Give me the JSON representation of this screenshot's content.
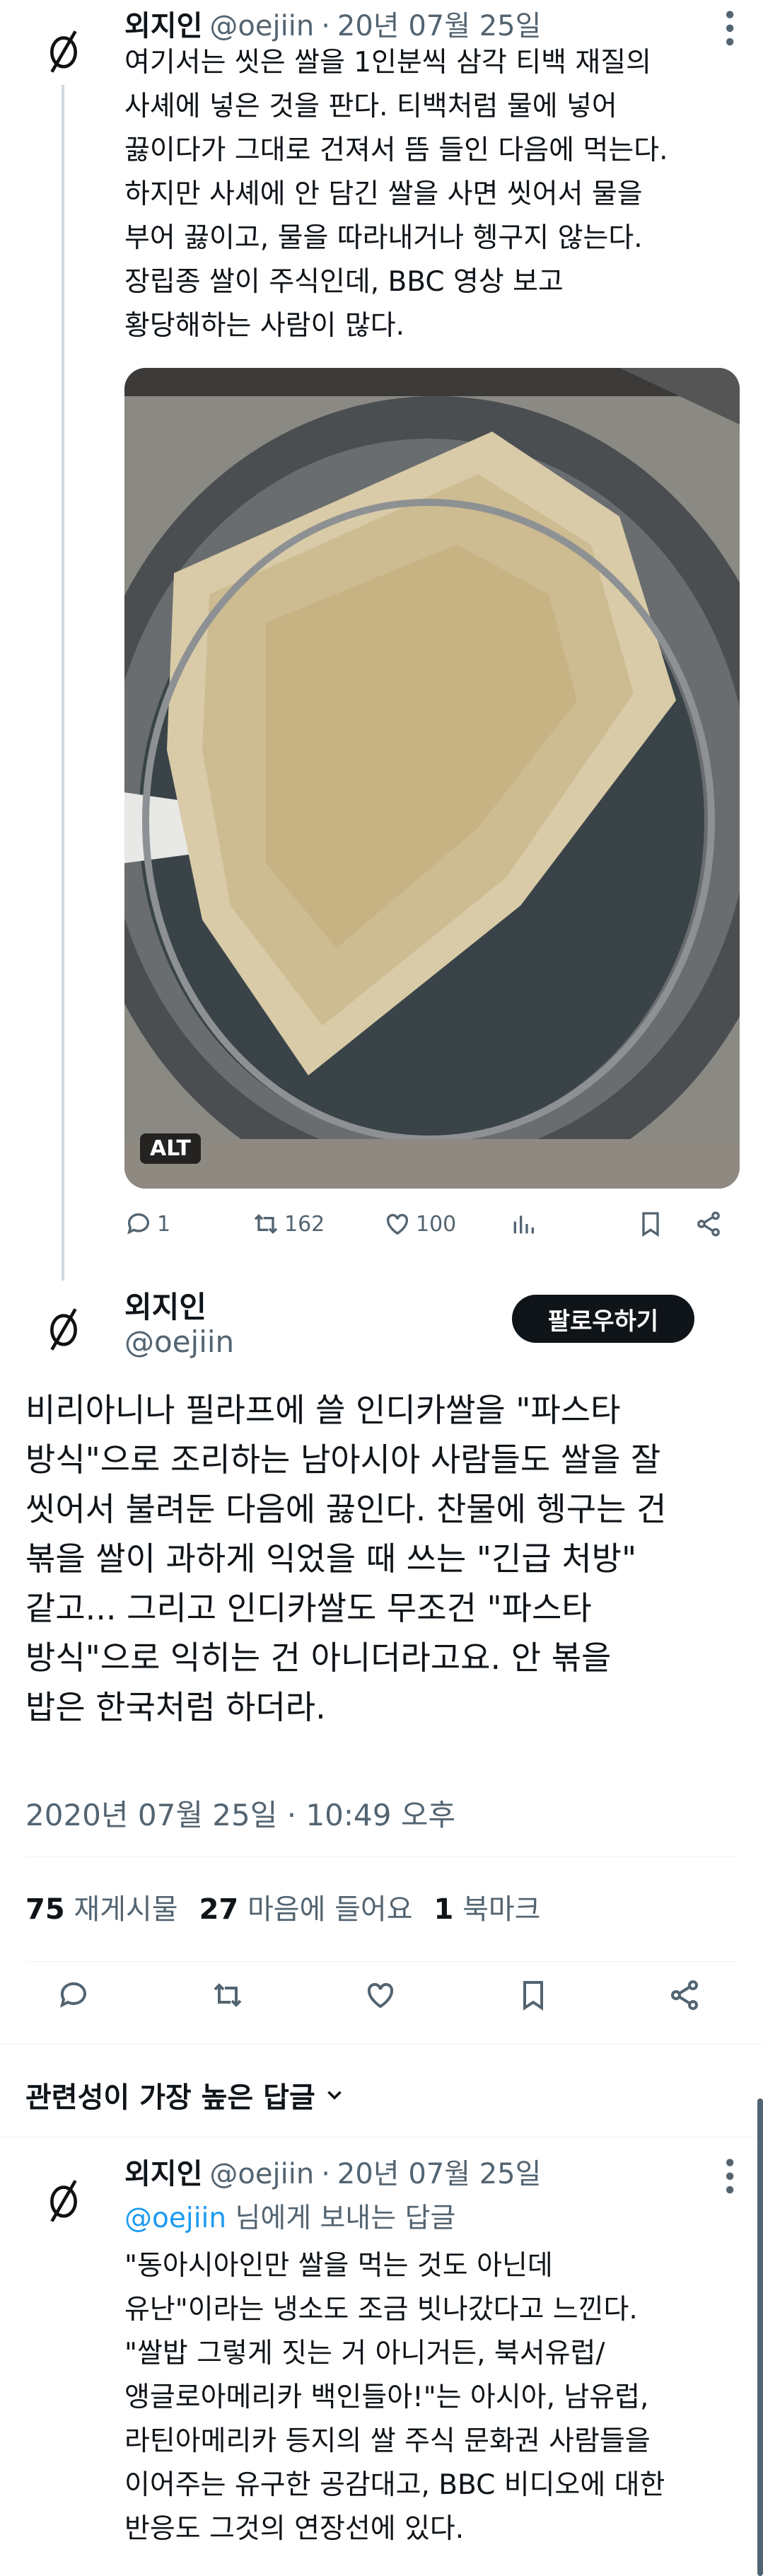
{
  "tweet1": {
    "name": "외지인",
    "handle": "@oejiin",
    "date": "20년 07월 25일",
    "text": "여기서는 씻은 쌀을 1인분씩 삼각 티백 재질의\n사셰에 넣은 것을 판다. 티백처럼 물에 넣어\n끓이다가 그대로 건져서 뜸 들인 다음에 먹는다.\n하지만 사셰에 안 담긴 쌀을 사면 씻어서 물을\n부어 끓이고, 물을 따라내거나 헹구지 않는다.\n장립종 쌀이 주식인데, BBC 영상 보고\n황당해하는 사람이 많다.",
    "alt_badge": "ALT",
    "replies": "1",
    "retweets": "162",
    "likes": "100"
  },
  "tweet2": {
    "name": "외지인",
    "handle": "@oejiin",
    "follow_label": "팔로우하기",
    "text": "비리아니나 필라프에 쓸 인디카쌀을 \"파스타\n방식\"으로 조리하는 남아시아 사람들도 쌀을 잘\n씻어서 불려둔 다음에 끓인다. 찬물에 헹구는 건\n볶을 쌀이 과하게 익었을 때 쓰는 \"긴급 처방\"\n같고... 그리고 인디카쌀도 무조건 \"파스타\n방식\"으로 익히는 건 아니더라고요. 안 볶을\n밥은 한국처럼 하더라.",
    "timestamp": "2020년 07월 25일 · 10:49 오후",
    "retweets_count": "75",
    "retweets_label": "재게시물",
    "likes_count": "27",
    "likes_label": "마음에 들어요",
    "bookmarks_count": "1",
    "bookmarks_label": "북마크"
  },
  "replies_header": {
    "label": "관련성이 가장 높은 답글"
  },
  "reply": {
    "name": "외지인",
    "handle": "@oejiin",
    "date": "20년 07월 25일",
    "reply_to_handle": "@oejiin",
    "reply_to_suffix": "님에게 보내는 답글",
    "text": "\"동아시아인만 쌀을 먹는 것도 아닌데\n유난\"이라는 냉소도 조금 빗나갔다고 느낀다.\n\"쌀밥 그렇게 짓는 거 아니거든, 북서유럽/\n앵글로아메리카 백인들아!\"는 아시아, 남유럽,\n라틴아메리카 등지의 쌀 주식 문화권 사람들을\n이어주는 유구한 공감대고, BBC 비디오에 대한\n반응도 그것의 연장선에 있다."
  },
  "colors": {
    "text": "#0f1419",
    "muted": "#536471",
    "link": "#1d9bf0",
    "button": "#0f1419",
    "divider": "#eff3f4"
  },
  "icons": {
    "avatar": "empty-set-symbol",
    "reply": "speech-bubble-icon",
    "retweet": "retweet-icon",
    "like": "heart-icon",
    "views": "bar-chart-icon",
    "bookmark": "bookmark-icon",
    "share": "share-icon",
    "more": "more-dots-icon",
    "chevron": "chevron-down-icon"
  }
}
